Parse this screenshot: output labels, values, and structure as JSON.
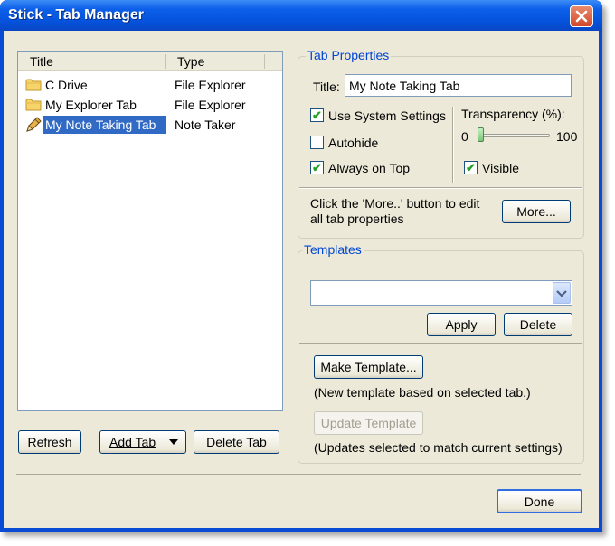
{
  "window": {
    "title": "Stick - Tab Manager"
  },
  "list": {
    "columns": [
      "Title",
      "Type"
    ],
    "rows": [
      {
        "title": "C Drive",
        "type": "File Explorer",
        "icon": "folder-icon"
      },
      {
        "title": "My Explorer Tab",
        "type": "File Explorer",
        "icon": "folder-icon"
      },
      {
        "title": "My Note Taking Tab",
        "type": "Note Taker",
        "icon": "pencil-icon",
        "selected": true
      }
    ]
  },
  "buttons": {
    "refresh": "Refresh",
    "add_tab": "Add Tab",
    "delete_tab": "Delete Tab",
    "done": "Done"
  },
  "tab_properties": {
    "legend": "Tab Properties",
    "title_label": "Title:",
    "title_value": "My Note Taking Tab",
    "use_system_settings": {
      "label": "Use System Settings",
      "checked": true
    },
    "autohide": {
      "label": "Autohide",
      "checked": false
    },
    "always_on_top": {
      "label": "Always on Top",
      "checked": true
    },
    "transparency_label": "Transparency (%):",
    "transparency_min": "0",
    "transparency_max": "100",
    "transparency_value": 0,
    "visible": {
      "label": "Visible",
      "checked": true
    },
    "more_hint": "Click the 'More..' button to edit all tab properties",
    "more_button": "More..."
  },
  "templates": {
    "legend": "Templates",
    "selected": "",
    "apply_button": "Apply",
    "delete_button": "Delete",
    "make_template_button": "Make Template...",
    "make_template_note": "(New template based on selected tab.)",
    "update_template_button": "Update Template",
    "update_template_note": "(Updates selected to match current settings)"
  },
  "colors": {
    "accent": "#316ac5",
    "titlebar": "#0552dc",
    "check": "#21a121",
    "legend": "#0046d5"
  }
}
